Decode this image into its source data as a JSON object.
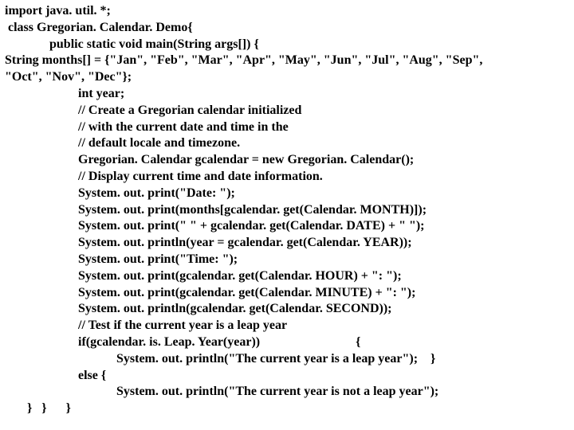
{
  "code": {
    "l1": "import java. util. *;",
    "l2": " class Gregorian. Calendar. Demo{",
    "l3": "              public static void main(String args[]) {",
    "l4": "String months[] = {\"Jan\", \"Feb\", \"Mar\", \"Apr\", \"May\", \"Jun\", \"Jul\", \"Aug\", \"Sep\",",
    "l5": "\"Oct\", \"Nov\", \"Dec\"};",
    "l6": "                       int year;",
    "l7": "                       // Create a Gregorian calendar initialized",
    "l8": "                       // with the current date and time in the",
    "l9": "                       // default locale and timezone.",
    "l10": "                       Gregorian. Calendar gcalendar = new Gregorian. Calendar();",
    "l11": "                       // Display current time and date information.",
    "l12": "                       System. out. print(\"Date: \");",
    "l13": "                       System. out. print(months[gcalendar. get(Calendar. MONTH)]);",
    "l14": "                       System. out. print(\" \" + gcalendar. get(Calendar. DATE) + \" \");",
    "l15": "                       System. out. println(year = gcalendar. get(Calendar. YEAR));",
    "l16": "                       System. out. print(\"Time: \");",
    "l17": "                       System. out. print(gcalendar. get(Calendar. HOUR) + \": \");",
    "l18": "                       System. out. print(gcalendar. get(Calendar. MINUTE) + \": \");",
    "l19": "                       System. out. println(gcalendar. get(Calendar. SECOND));",
    "l20": "                       // Test if the current year is a leap year",
    "l21": "                       if(gcalendar. is. Leap. Year(year))                              {",
    "l22": "                                   System. out. println(\"The current year is a leap year\");    }",
    "l23": "                       else {",
    "l24": "                                   System. out. println(\"The current year is not a leap year\");",
    "l25": "       }   }      }"
  }
}
